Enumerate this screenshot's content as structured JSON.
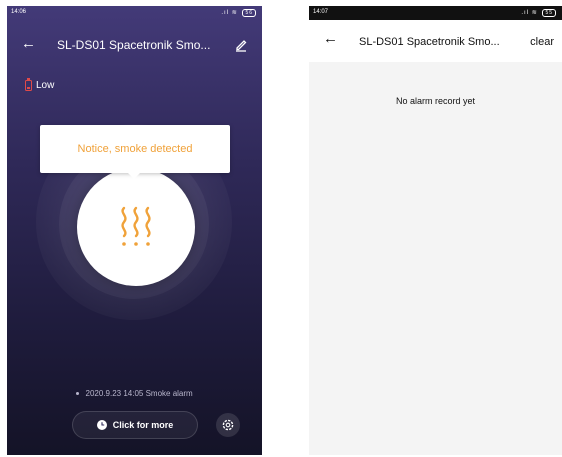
{
  "left": {
    "status_time": "14:06",
    "status_battery": "56",
    "title": "SL-DS01 Spacetronik Smo...",
    "battery_status": "Low",
    "notice": "Notice, smoke detected",
    "last_event": "2020.9.23 14:05 Smoke alarm",
    "more_label": "Click for more",
    "colors": {
      "accent": "#f0a23a",
      "battery_low": "#e04a4a",
      "bg_top": "#433a78",
      "bg_bottom": "#141327"
    },
    "icons": [
      "back-arrow-icon",
      "edit-icon",
      "battery-low-icon",
      "smoke-icon",
      "clock-icon",
      "settings-icon"
    ]
  },
  "right": {
    "status_time": "14:07",
    "status_battery": "55",
    "title": "SL-DS01 Spacetronik Smo...",
    "clear_label": "clear",
    "empty_message": "No alarm record yet"
  }
}
